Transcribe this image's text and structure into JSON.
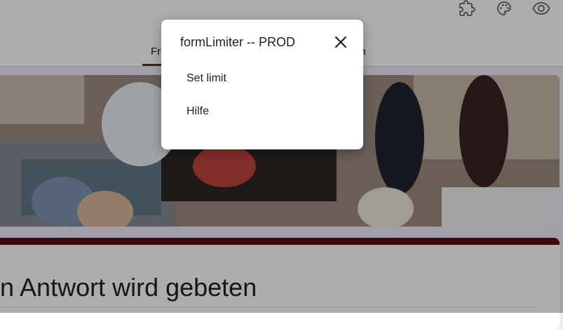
{
  "header": {
    "icons": [
      "puzzle-icon",
      "palette-icon",
      "eye-icon"
    ],
    "tabs": [
      {
        "label": "Fr",
        "active": true
      },
      {
        "label": "en",
        "active": false
      }
    ]
  },
  "form": {
    "title": "n Antwort wird gebeten",
    "accent_color": "#5b0f16"
  },
  "dialog": {
    "title": "formLimiter -- PROD",
    "items": [
      {
        "label": "Set limit"
      },
      {
        "label": "Hilfe"
      }
    ]
  }
}
